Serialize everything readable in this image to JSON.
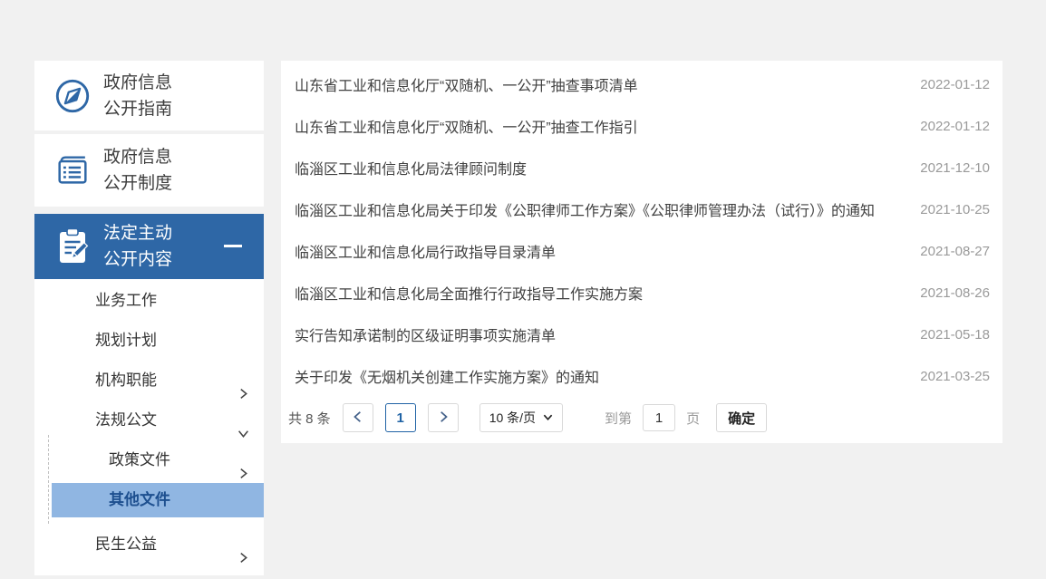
{
  "colors": {
    "accent_blue": "#2e67a6",
    "active_submenu_bg": "#90b6e2",
    "active_submenu_text": "#1d4f8f",
    "page_active_blue": "#2063a5",
    "date_text": "#9a9a9a",
    "page_background": "#f1f1f1"
  },
  "sidebar": {
    "guide": {
      "icon": "compass-icon",
      "line1": "政府信息",
      "line2": "公开指南"
    },
    "system": {
      "icon": "book-icon",
      "line1": "政府信息",
      "line2": "公开制度"
    },
    "section": {
      "icon": "clipboard-pen-icon",
      "line1": "法定主动",
      "line2": "公开内容",
      "collapse_icon": "minus-icon"
    },
    "menu": [
      {
        "label": "业务工作",
        "arrow": "none"
      },
      {
        "label": "规划计划",
        "arrow": "none"
      },
      {
        "label": "机构职能",
        "arrow": "chevron-right"
      },
      {
        "label": "法规公文",
        "arrow": "chevron-down"
      },
      {
        "label": "政策文件",
        "arrow": "chevron-right",
        "submenu": true
      },
      {
        "label": "其他文件",
        "arrow": "none",
        "submenu": true,
        "active": true
      },
      {
        "label": "民生公益",
        "arrow": "chevron-right"
      }
    ]
  },
  "main": {
    "rows": [
      {
        "title": "山东省工业和信息化厅“双随机、一公开”抽查事项清单",
        "date": "2022-01-12"
      },
      {
        "title": "山东省工业和信息化厅“双随机、一公开”抽查工作指引",
        "date": "2022-01-12"
      },
      {
        "title": "临淄区工业和信息化局法律顾问制度",
        "date": "2021-12-10"
      },
      {
        "title": "临淄区工业和信息化局关于印发《公职律师工作方案》《公职律师管理办法（试行）》的通知",
        "date": "2021-10-25"
      },
      {
        "title": "临淄区工业和信息化局行政指导目录清单",
        "date": "2021-08-27"
      },
      {
        "title": "临淄区工业和信息化局全面推行行政指导工作实施方案",
        "date": "2021-08-26"
      },
      {
        "title": "实行告知承诺制的区级证明事项实施清单",
        "date": "2021-05-18"
      },
      {
        "title": "关于印发《无烟机关创建工作实施方案》的通知",
        "date": "2021-03-25"
      }
    ],
    "pagination": {
      "total_label": "共 8 条",
      "prev_icon": "chevron-left-icon",
      "current_page": "1",
      "next_icon": "chevron-right-icon",
      "page_size_label": "10 条/页",
      "page_size_caret": "chevron-down-icon",
      "goto_prefix": "到第",
      "goto_value": "1",
      "goto_suffix": "页",
      "confirm_label": "确定"
    }
  }
}
